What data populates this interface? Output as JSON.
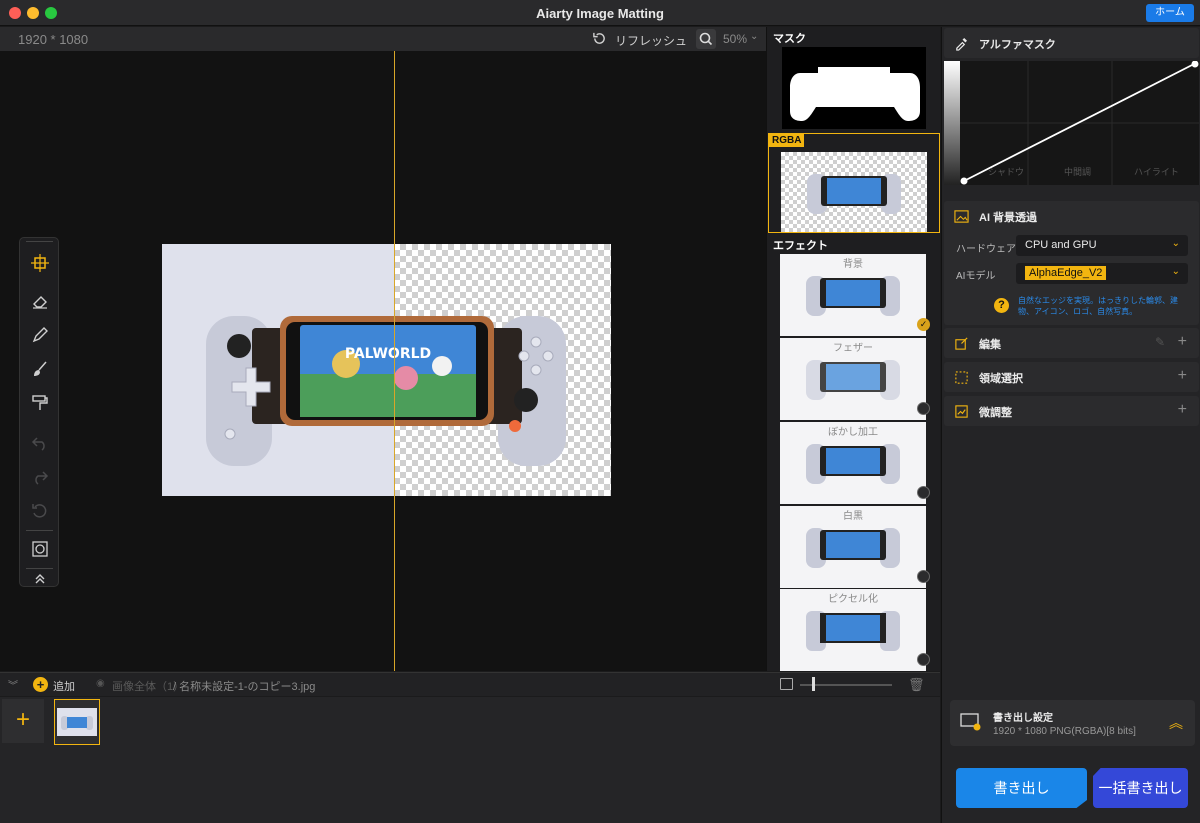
{
  "window": {
    "title": "Aiarty Image Matting",
    "home_button": "ホーム"
  },
  "canvas": {
    "resolution": "1920 * 1080",
    "refresh_label": "リフレッシュ",
    "zoom_value": "50%"
  },
  "toolbar": {
    "tools": [
      "move-icon",
      "eraser-icon",
      "pencil-icon",
      "brush-icon",
      "roller-icon",
      "undo-icon",
      "redo-icon",
      "reset-icon",
      "compare-icon",
      "collapse-up-icon"
    ]
  },
  "bottombar": {
    "add_label": "追加",
    "all_images": "画像全体（1）",
    "file_path": "/ 名称未設定-1-のコピー3.jpg"
  },
  "mid": {
    "mask_label": "マスク",
    "rgba_label": "RGBA",
    "effects_label": "エフェクト",
    "effects": [
      {
        "name": "背景",
        "selected": true
      },
      {
        "name": "フェザー",
        "selected": false
      },
      {
        "name": "ぼかし加工",
        "selected": false
      },
      {
        "name": "白黒",
        "selected": false
      },
      {
        "name": "ピクセル化",
        "selected": false
      }
    ]
  },
  "right": {
    "alpha_mask_title": "アルファマスク",
    "curve_labels": [
      "シャドウ",
      "中間調",
      "ハイライト"
    ],
    "ai_title": "AI 背景透過",
    "hardware_label": "ハードウェア",
    "hardware_value": "CPU and GPU",
    "model_label": "AIモデル",
    "model_value": "AlphaEdge_V2",
    "help_text": "自然なエッジを実現。はっきりした輪郭、建物、アイコン、ロゴ、自然写真。",
    "sections": [
      "編集",
      "領域選択",
      "微調整"
    ],
    "export_title": "書き出し設定",
    "export_spec": "1920 * 1080 PNG(RGBA)[8 bits]",
    "export_button": "書き出し",
    "batch_button": "一括書き出し"
  },
  "colors": {
    "accent": "#f2b510",
    "blue": "#1a86e8",
    "batch": "#3448d8"
  }
}
